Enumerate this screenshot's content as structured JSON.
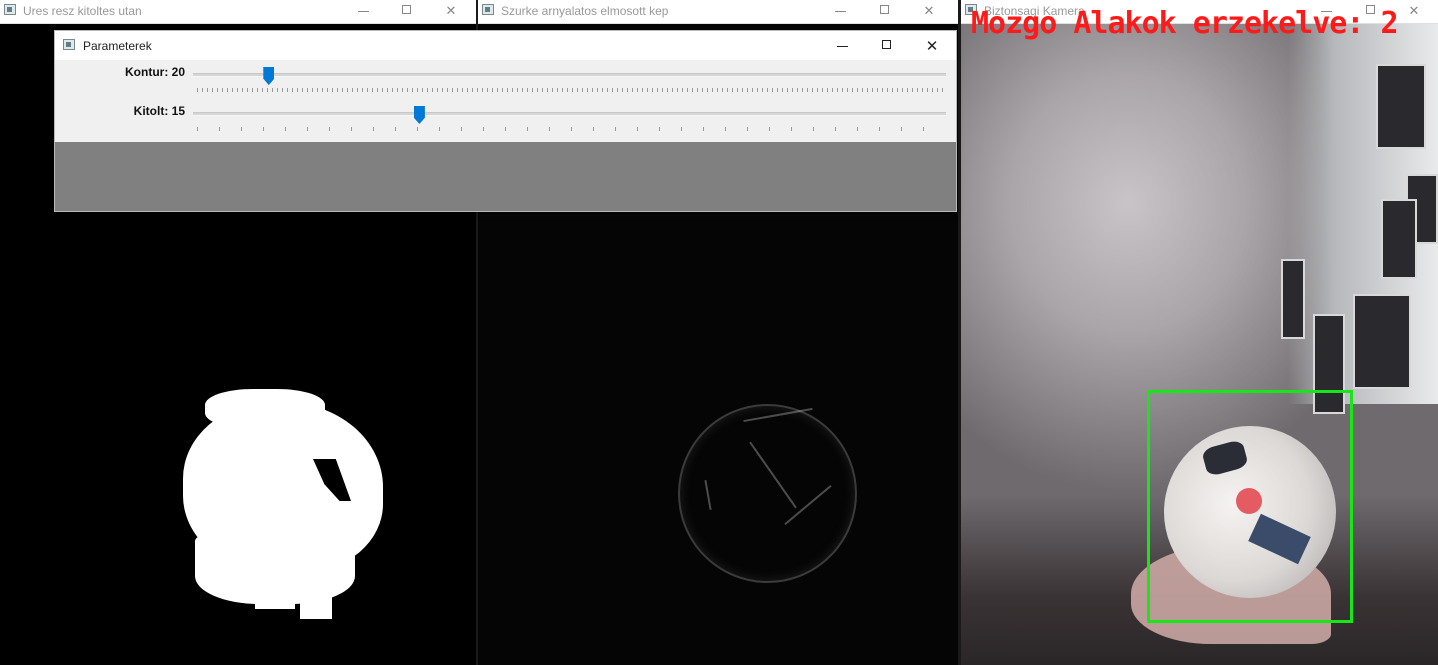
{
  "windows": {
    "fill": {
      "title": "Ures resz kitoltes utan"
    },
    "blur": {
      "title": "Szurke arnyalatos elmosott kep"
    },
    "camera": {
      "title": "Biztonsagi Kamera",
      "overlay_text": "Mozgo Alakok erzekelve: 2",
      "overlay_color": "#ff1a1a",
      "bounding_box_color": "#19e619"
    }
  },
  "parameters_dialog": {
    "title": "Parameterek",
    "sliders": [
      {
        "label": "Kontur: 20",
        "value": 20,
        "max": 200
      },
      {
        "label": "Kitolt: 15",
        "value": 15,
        "max": 50
      }
    ],
    "accent": "#0078d7"
  },
  "icons": [
    "window-app-icon",
    "minimize-icon",
    "maximize-icon",
    "close-icon"
  ]
}
